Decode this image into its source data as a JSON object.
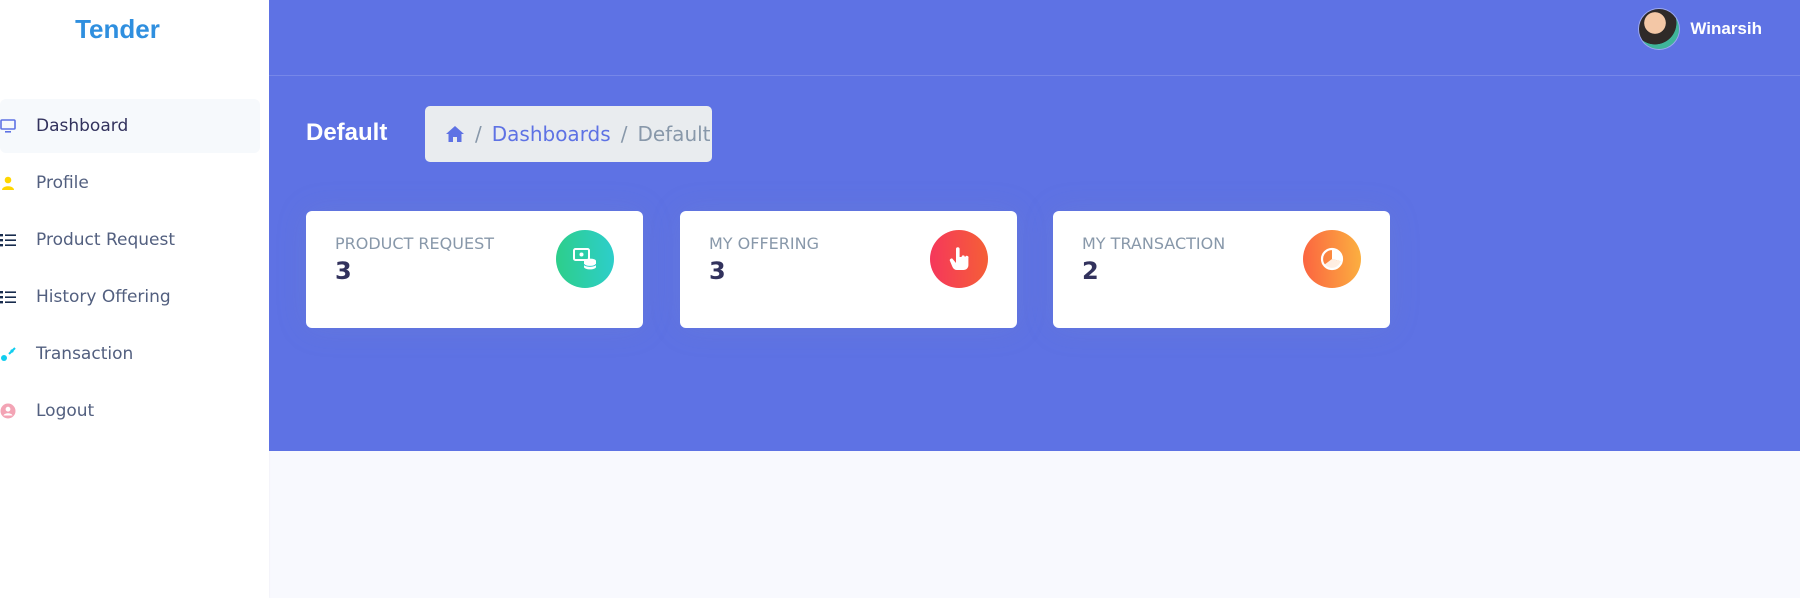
{
  "app": {
    "brand": "Tender"
  },
  "sidebar": {
    "items": [
      {
        "label": "Dashboard",
        "icon": "monitor-icon",
        "color": "#5e72e4",
        "active": true
      },
      {
        "label": "Profile",
        "icon": "user-icon",
        "color": "#ffd600"
      },
      {
        "label": "Product Request",
        "icon": "list-icon",
        "color": "#172b4d"
      },
      {
        "label": "History Offering",
        "icon": "list-icon",
        "color": "#172b4d"
      },
      {
        "label": "Transaction",
        "icon": "planet-icon",
        "color": "#11cdef"
      },
      {
        "label": "Logout",
        "icon": "logout-icon",
        "color": "#f3a4b5"
      }
    ]
  },
  "topbar": {
    "user_name": "Winarsih"
  },
  "header": {
    "title": "Default",
    "breadcrumb": {
      "home_icon": "home-icon",
      "link": "Dashboards",
      "current": "Default",
      "separator": "/"
    }
  },
  "cards": [
    {
      "title": "PRODUCT REQUEST",
      "value": "3",
      "icon": "money-coins-icon",
      "color": "#2dce89"
    },
    {
      "title": "MY OFFERING",
      "value": "3",
      "icon": "hand-pointer-icon",
      "color": "#f5365c"
    },
    {
      "title": "MY TRANSACTION",
      "value": "2",
      "icon": "pie-chart-icon",
      "color": "#fb6340"
    }
  ],
  "colors": {
    "primary": "#5e72e4",
    "background": "#f8f9fe"
  }
}
